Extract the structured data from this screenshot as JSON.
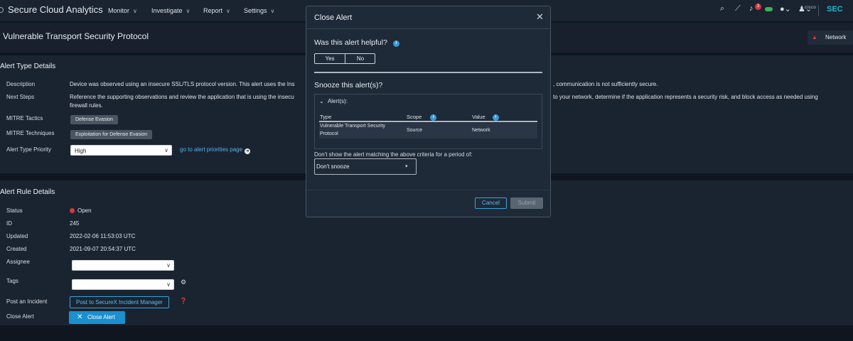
{
  "topnav": {
    "app_title": "Secure Cloud Analytics",
    "menu": [
      "Monitor",
      "Investigate",
      "Report",
      "Settings"
    ],
    "notification_count": "3",
    "cisco_logo": "cisco",
    "cisco_suffix": "SEC",
    "icons": [
      "search-icon",
      "chart-icon",
      "bell-icon",
      "cloud-icon",
      "help-icon",
      "user-icon"
    ]
  },
  "page": {
    "title": "Vulnerable Transport Security Protocol",
    "network_chip": "Network"
  },
  "alert_type": {
    "heading": "Alert Type Details",
    "description_label": "Description",
    "description_text": "Device was observed using an insecure SSL/TLS protocol version. This alert uses the Ins",
    "description_tail": ", communication is not sufficiently secure.",
    "next_steps_label": "Next Steps",
    "next_steps_text": "Reference the supporting observations and review the application that is using the insecu",
    "next_steps_tail": "to your network, determine if the application represents a security risk, and block access as needed using",
    "next_steps_line2": "firewall rules.",
    "mitre_tactics_label": "MITRE Tactics",
    "mitre_tactics_value": "Defense Evasion",
    "mitre_techniques_label": "MITRE Techniques",
    "mitre_techniques_value": "Exploitation for Defense Evasion",
    "priority_label": "Alert Type Priority",
    "priority_value": "High",
    "priority_link": "go to alert priorities page"
  },
  "alert_rule": {
    "heading": "Alert Rule Details",
    "status_label": "Status",
    "status_value": "Open",
    "id_label": "ID",
    "id_value": "245",
    "updated_label": "Updated",
    "updated_value": "2022-02-06 11:53:03 UTC",
    "created_label": "Created",
    "created_value": "2021-09-07 20:54:37 UTC",
    "assignee_label": "Assignee",
    "tags_label": "Tags",
    "incident_label": "Post an Incident",
    "incident_button": "Post to SecureX Incident Manager",
    "close_label": "Close Alert",
    "close_button": "Close Alert"
  },
  "modal": {
    "title": "Close Alert",
    "helpful_question": "Was this alert helpful?",
    "yes": "Yes",
    "no": "No",
    "snooze_question": "Snooze this alert(s)?",
    "alerts_header": "Alert(s):",
    "columns": [
      "Type",
      "Scope",
      "Value"
    ],
    "row": {
      "type_line1": "Vulnerable Transport Security",
      "type_line2": "Protocol",
      "scope": "Source",
      "value": "Network"
    },
    "period_label": "Don't show the alert matching the above criteria for a period of:",
    "snooze_value": "Don't snooze",
    "cancel": "Cancel",
    "submit": "Submit"
  },
  "colors": {
    "accent": "#1b8fd0",
    "status_open": "#d33a3a",
    "cisco_brand": "#1fb5c6"
  }
}
